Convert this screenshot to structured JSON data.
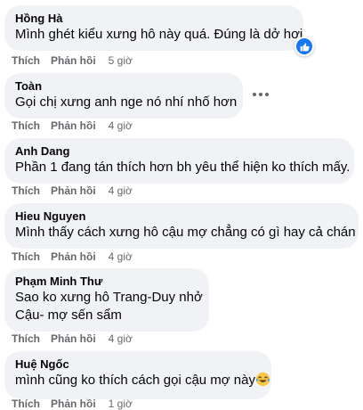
{
  "actions": {
    "like": "Thích",
    "reply": "Phản hồi"
  },
  "comments": [
    {
      "author": "Hồng Hà",
      "lines": [
        "Mình ghét kiểu xưng hô này quá. Đúng là dở hơi"
      ],
      "time": "5 giờ",
      "reaction": "like-icon"
    },
    {
      "author": "Toàn",
      "lines": [
        "Gọi chị xưng anh nge nó nhí nhố hơn"
      ],
      "time": "4 giờ"
    },
    {
      "author": "Anh Dang",
      "lines": [
        "Phần 1 đang tán thích hơn bh yêu thể hiện ko thích mấy."
      ],
      "time": "4 giờ"
    },
    {
      "author": "Hieu Nguyen",
      "lines": [
        "Mình thấy cách xưng hô cậu mợ chẳng có gì hay cả chán"
      ],
      "time": "4 giờ"
    },
    {
      "author": "Phạm Minh Thư",
      "lines": [
        "Sao ko xưng hô Trang-Duy nhở",
        "Cậu- mợ sến sẩm"
      ],
      "time": "4 giờ"
    },
    {
      "author": "Huệ Ngốc",
      "lines": [
        "mình cũng ko thích cách gọi cậu mợ này"
      ],
      "time": "1 giờ",
      "emoji": "laughing-tears-emoji"
    }
  ]
}
